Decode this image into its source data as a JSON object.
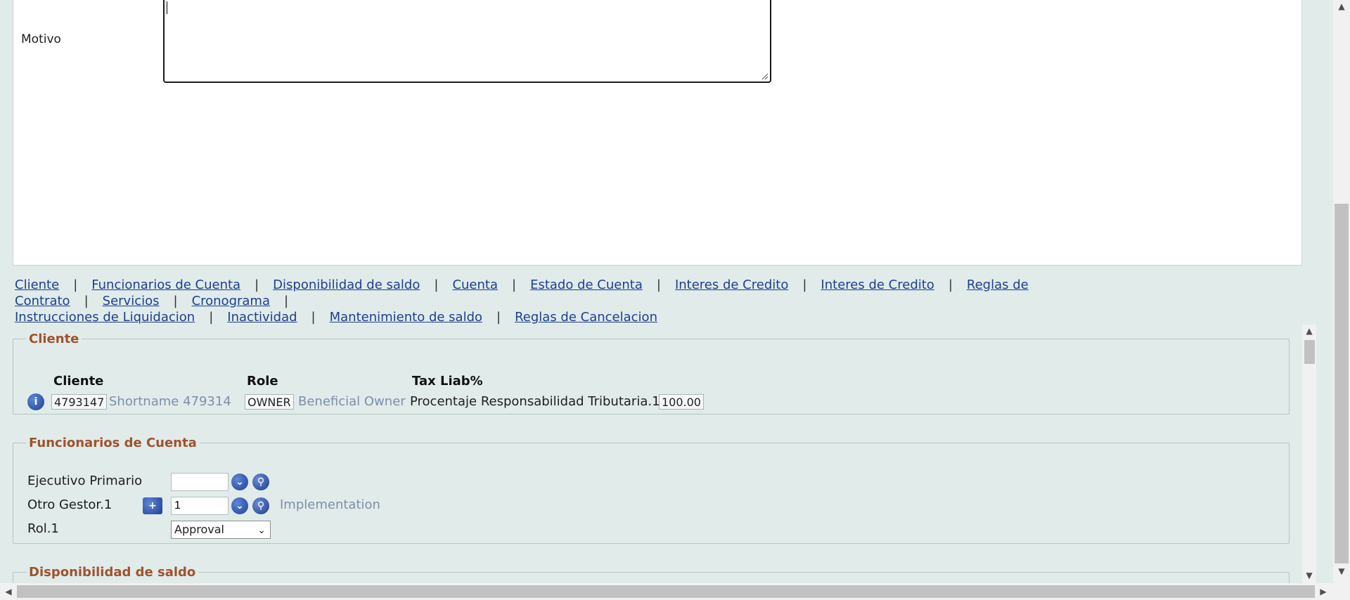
{
  "motivo": {
    "label": "Motivo",
    "value": ""
  },
  "nav_links": [
    "Cliente",
    "Funcionarios de Cuenta",
    "Disponibilidad de saldo",
    "Cuenta",
    "Estado de Cuenta",
    "Interes de Credito",
    "Interes de Credito",
    "Reglas de Contrato",
    "Servicios",
    "Cronograma",
    "Instrucciones de Liquidacion",
    "Inactividad",
    "Mantenimiento de saldo",
    "Reglas de Cancelacion"
  ],
  "separator": "|",
  "cliente_section": {
    "legend": "Cliente",
    "headers": {
      "cliente": "Cliente",
      "role": "Role",
      "tax": "Tax Liab%"
    },
    "client_id": "4793147",
    "shortname": "Shortname 479314",
    "role_code": "OWNER",
    "role_desc": "Beneficial Owner",
    "tax_label": "Procentaje Responsabilidad Tributaria.1",
    "tax_value": "100.00",
    "info_icon": "info-icon"
  },
  "funcionarios_section": {
    "legend": "Funcionarios de Cuenta",
    "ejecutivo_label": "Ejecutivo Primario",
    "ejecutivo_value": "",
    "otro_label": "Otro Gestor.1",
    "otro_value": "1",
    "otro_desc": "Implementation",
    "rol_label": "Rol.1",
    "rol_value": "Approval",
    "icons": {
      "dropdown": "chevron-down-icon",
      "lookup": "magnifier-icon",
      "add": "plus-icon"
    }
  },
  "disponibilidad_section": {
    "legend": "Disponibilidad de saldo"
  },
  "colors": {
    "legend": "#a0522d",
    "link": "#1d3f8f",
    "muted": "#7e8fa8",
    "background": "#e1ebea"
  }
}
